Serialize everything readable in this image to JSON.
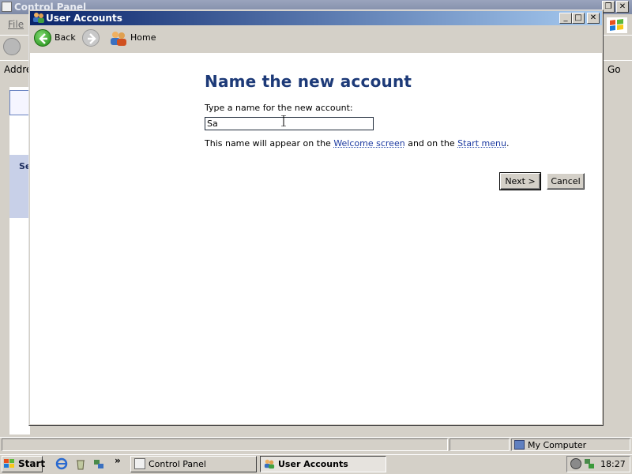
{
  "control_panel": {
    "title": "Control Panel",
    "menu_file": "File",
    "address_label": "Addre",
    "go_label": "Go",
    "side_panel_label": "Se",
    "status_zone": "My Computer"
  },
  "user_accounts": {
    "title": "User Accounts",
    "nav": {
      "back_label": "Back",
      "home_label": "Home"
    },
    "page_title": "Name the new account",
    "prompt": "Type a name for the new account:",
    "input_value": "Sa",
    "hint": {
      "prefix": "This name will appear on the ",
      "link1": "Welcome screen",
      "middle": " and on the ",
      "link2": "Start menu",
      "suffix": "."
    },
    "buttons": {
      "next": "Next >",
      "cancel": "Cancel"
    }
  },
  "taskbar": {
    "start_label": "Start",
    "quick_launch_icons": [
      "ie-icon",
      "recycle-icon",
      "network-icon"
    ],
    "tasks": [
      "Control Panel",
      "User Accounts"
    ],
    "active_task": "User Accounts",
    "clock": "18:27"
  },
  "colors": {
    "title_active_start": "#0a246a",
    "title_active_end": "#a6caf0",
    "page_title": "#1d3a78",
    "link": "#1c3aa0",
    "face": "#d4d0c8"
  }
}
